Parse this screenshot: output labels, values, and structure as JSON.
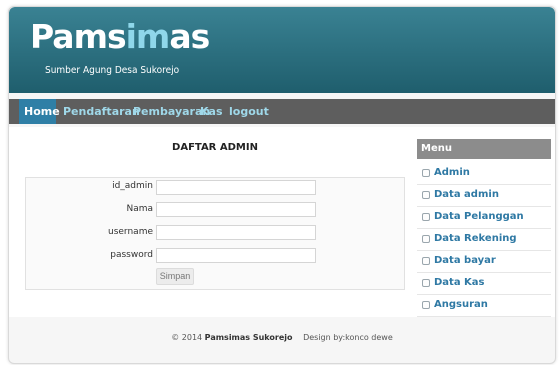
{
  "header": {
    "logo_part1": "Pams",
    "logo_part2": "im",
    "logo_part3": "as",
    "tagline": "Sumber Agung Desa Sukorejo"
  },
  "nav": {
    "items": [
      {
        "label": "Home",
        "active": true
      },
      {
        "label": "Pendaftaran"
      },
      {
        "label": "Pembayaran"
      },
      {
        "label": "Kas"
      },
      {
        "label": "logout"
      }
    ]
  },
  "main": {
    "title": "DAFTAR ADMIN",
    "form": {
      "fields": [
        {
          "label": "id_admin",
          "value": ""
        },
        {
          "label": "Nama",
          "value": ""
        },
        {
          "label": "username",
          "value": ""
        },
        {
          "label": "password",
          "value": ""
        }
      ],
      "submit_label": "Simpan"
    }
  },
  "sidebar": {
    "title": "Menu",
    "items": [
      {
        "label": "Admin"
      },
      {
        "label": "Data admin"
      },
      {
        "label": "Data Pelanggan"
      },
      {
        "label": "Data Rekening"
      },
      {
        "label": "Data bayar"
      },
      {
        "label": "Data Kas"
      },
      {
        "label": "Angsuran"
      }
    ]
  },
  "footer": {
    "copyright_prefix": "© 2014",
    "site_name": "Pamsimas Sukorejo",
    "credit": "Design by:konco dewe"
  },
  "colors": {
    "header_bg": "#2a6f80",
    "nav_bg": "#5e5e5e",
    "nav_active": "#2f7fa6",
    "nav_text": "#9fd8e9",
    "logo_highlight": "#8fd7ea",
    "sidebar_link": "#2f79a4"
  },
  "icons": {
    "sidebar_bullet": "square-bullet-icon"
  }
}
